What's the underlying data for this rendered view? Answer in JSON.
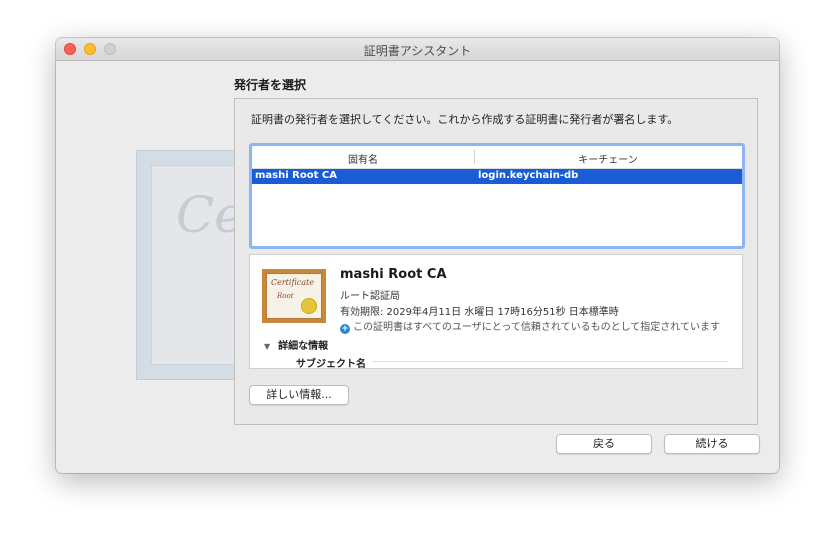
{
  "window": {
    "title": "証明書アシスタント"
  },
  "section": {
    "title": "発行者を選択"
  },
  "instruction": "証明書の発行者を選択してください。これから作成する証明書に発行者が署名します。",
  "table": {
    "headers": [
      "固有名",
      "キーチェーン"
    ],
    "rows": [
      {
        "name": "mashi Root CA",
        "keychain": "login.keychain-db",
        "selected": true
      }
    ]
  },
  "details": {
    "name": "mashi Root CA",
    "type": "ルート認証局",
    "expiry": "有効期限: 2029年4月11日 水曜日 17時16分51秒 日本標準時",
    "trust": "この証明書はすべてのユーザにとって信頼されているものとして指定されています",
    "toggle_label": "詳細な情報",
    "subject_label": "サブジェクト名",
    "icon": {
      "line1": "Certificate",
      "line2": "Root"
    }
  },
  "buttons": {
    "more_info": "詳しい情報...",
    "back": "戻る",
    "continue": "続ける"
  },
  "colors": {
    "selection": "#1a5cd6",
    "focus_ring": "#8fb5f0",
    "close": "#fe5f57",
    "minimize": "#febc2e",
    "zoom_disabled": "#d0d0d0",
    "info_icon": "#2a84d9"
  }
}
